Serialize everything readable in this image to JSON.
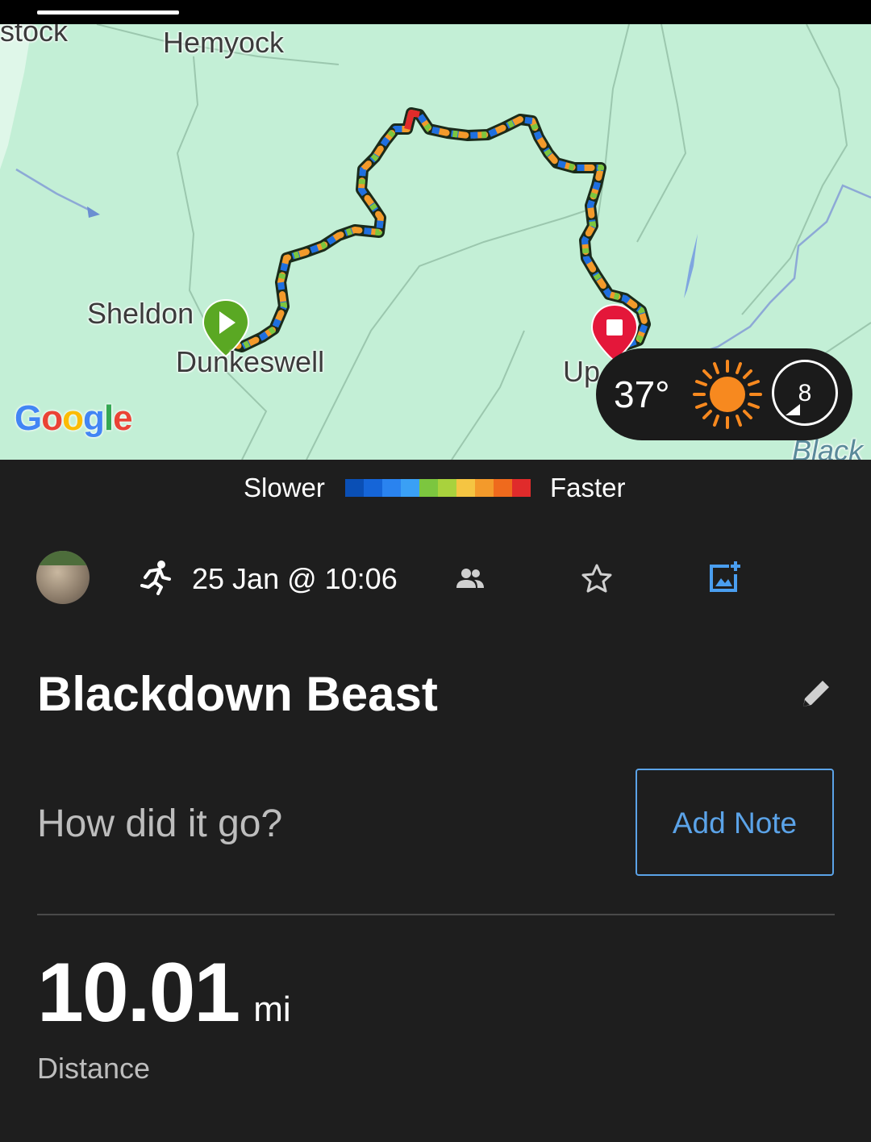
{
  "map": {
    "place_labels": {
      "top_left_partial": "stock",
      "hemyock": "Hemyock",
      "sheldon": "Sheldon",
      "dunkeswell": "Dunkeswell",
      "upottery_partial": "Up",
      "blackdown_partial": "Black"
    },
    "attribution": "Google",
    "start_marker": "play-icon",
    "end_marker": "stop-icon"
  },
  "weather": {
    "temperature": "37°",
    "condition_icon": "sun-icon",
    "wind_speed": "8"
  },
  "pace_legend": {
    "slower": "Slower",
    "faster": "Faster",
    "colors": [
      "#0a4fb5",
      "#1565d8",
      "#2a83ef",
      "#3aa0f5",
      "#7cc63f",
      "#a9d23d",
      "#f5c542",
      "#f39a2b",
      "#ef6a1d",
      "#e02b2b"
    ]
  },
  "activity": {
    "type_icon": "running-icon",
    "date": "25 Jan @ 10:06",
    "privacy_icon": "people-icon",
    "favorite_icon": "star-outline-icon",
    "add_photo_icon": "add-photo-icon",
    "title": "Blackdown Beast",
    "note_prompt": "How did it go?",
    "add_note_label": "Add Note",
    "distance_value": "10.01",
    "distance_unit": "mi",
    "distance_label": "Distance"
  },
  "colors": {
    "accent": "#5ba3e8",
    "background": "#1e1e1e",
    "map_land": "#c3efd6",
    "start_green": "#5aa823",
    "end_red": "#e4173a"
  }
}
